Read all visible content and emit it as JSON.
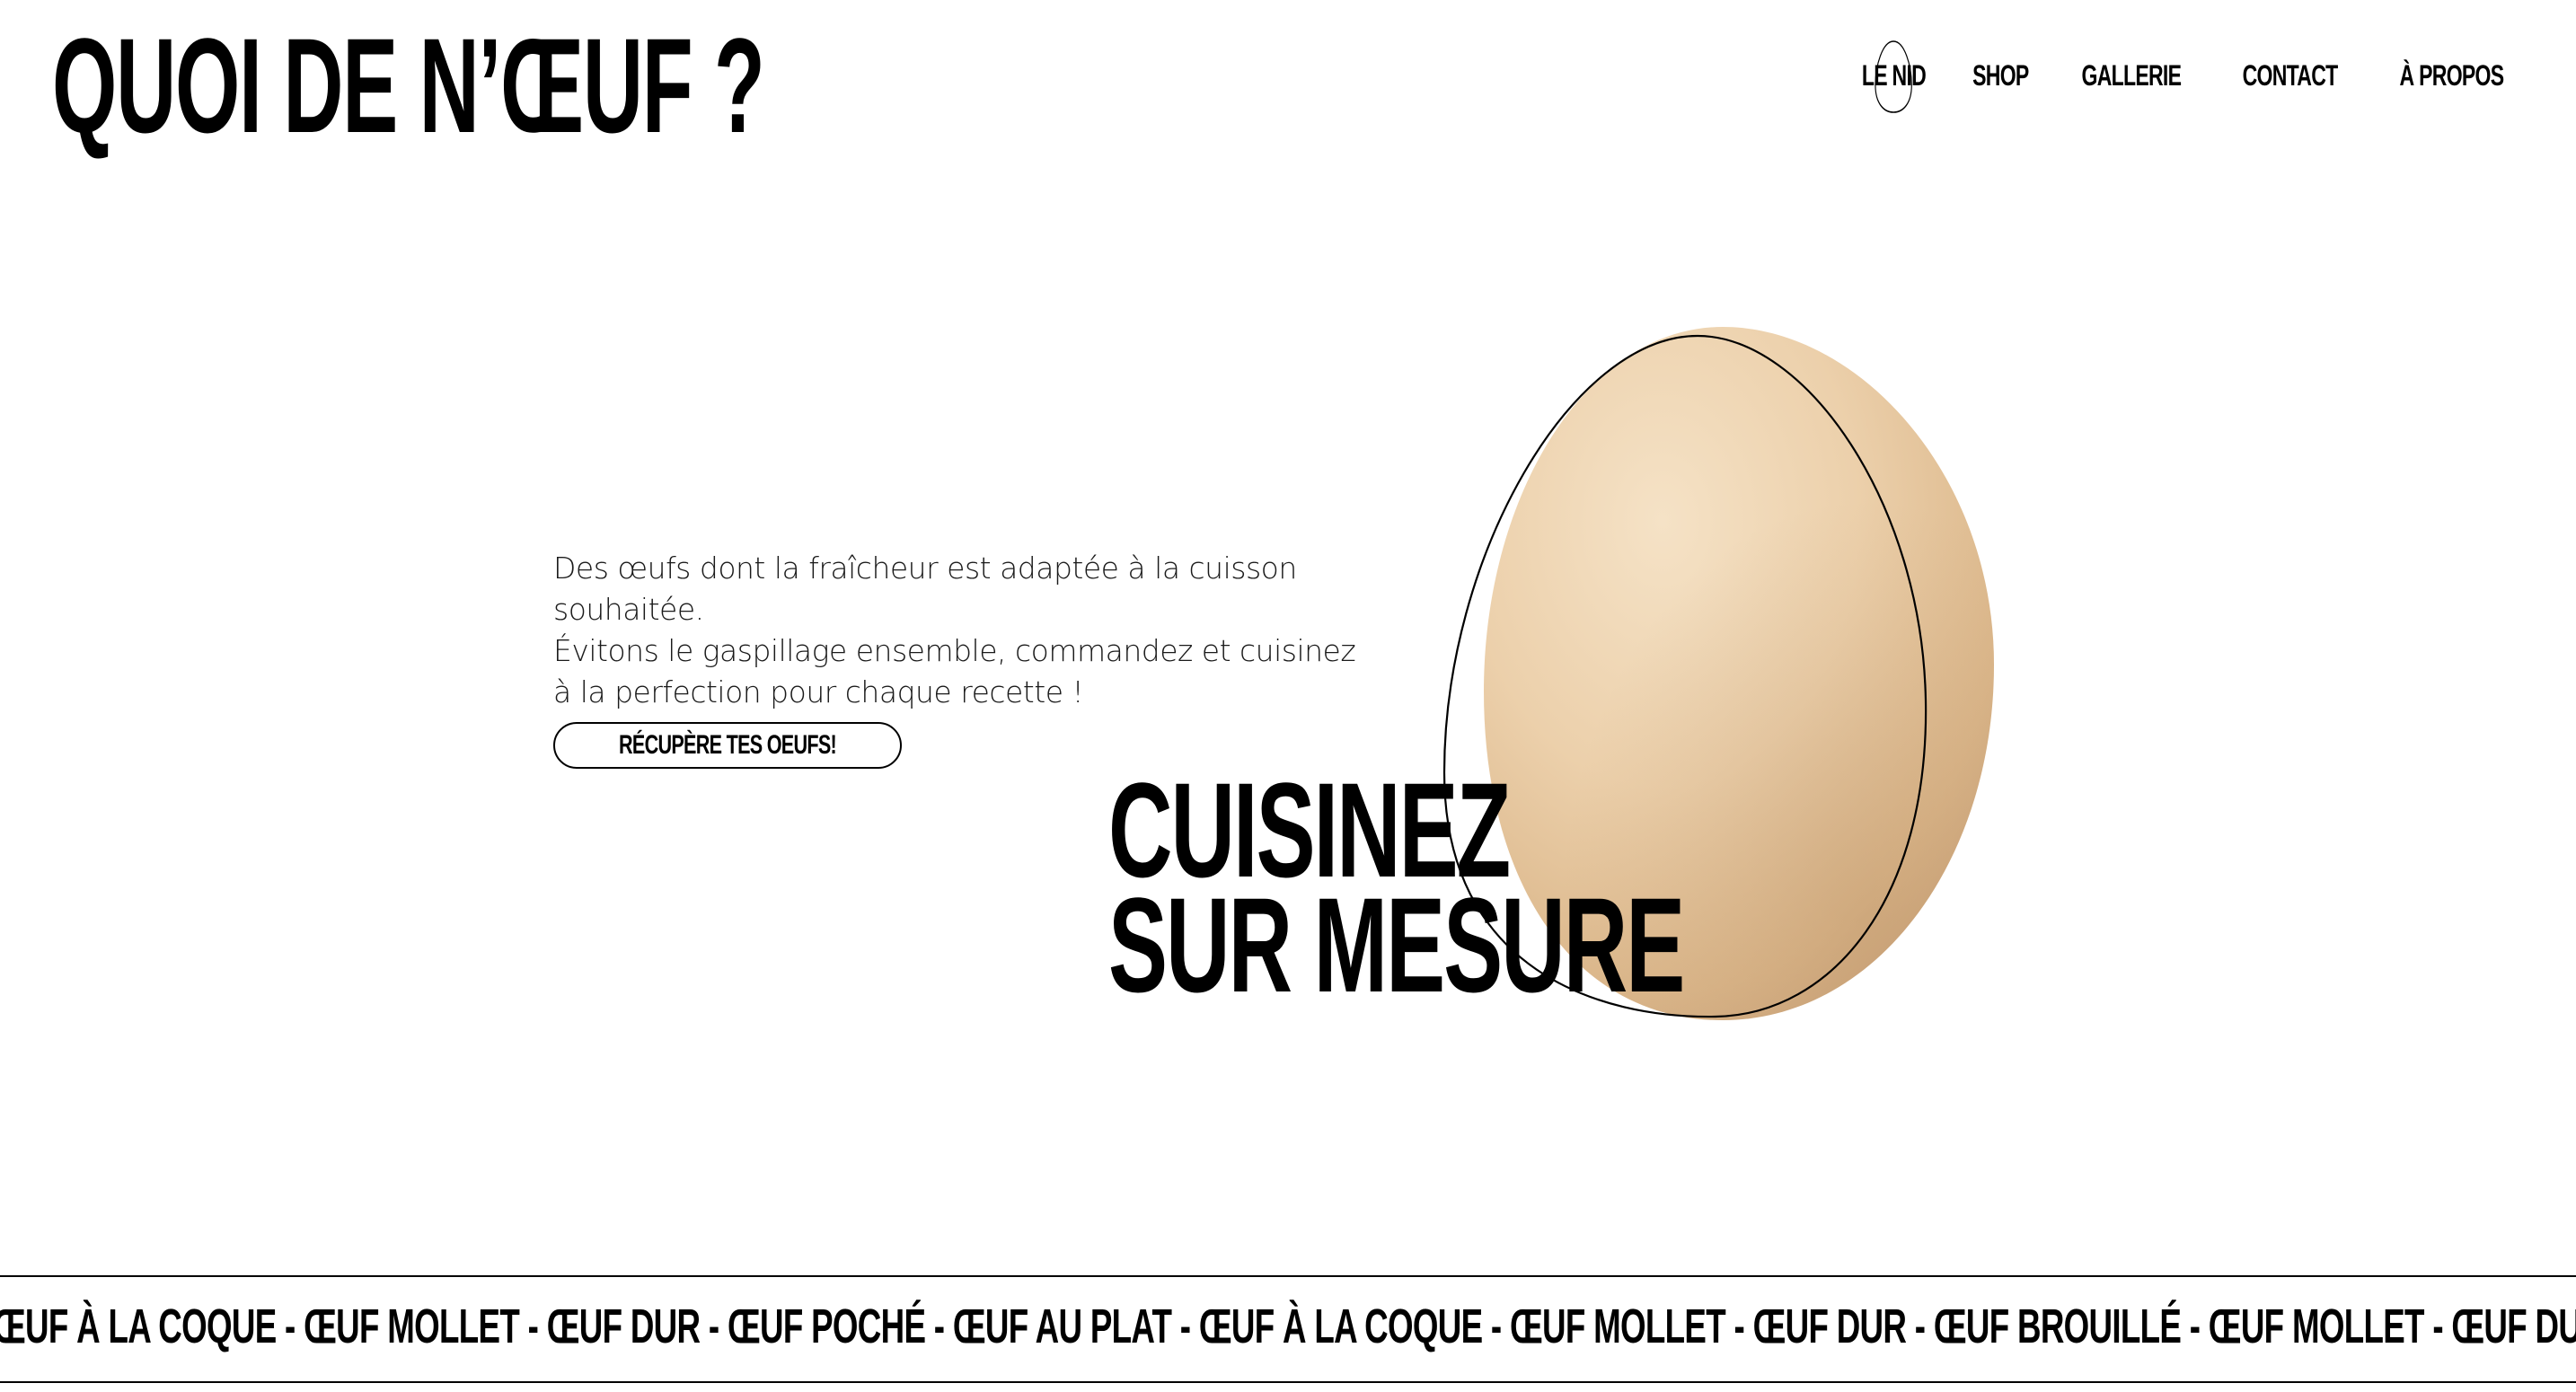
{
  "brand": {
    "logo": "QUOI DE N’ŒUF ?"
  },
  "nav": {
    "items": [
      {
        "label": "LE NID"
      },
      {
        "label": "SHOP"
      },
      {
        "label": "GALLERIE"
      },
      {
        "label": "CONTACT"
      },
      {
        "label": "À PROPOS"
      }
    ]
  },
  "hero": {
    "intro_lines": [
      "Des œufs dont la fraîcheur est adaptée à la cuisson souhaitée.",
      "Évitons le gaspillage ensemble, commandez et cuisinez",
      "à la perfection pour chaque recette !"
    ],
    "cta_label": "RÉCUPÈRE TES OEUFS!",
    "headline_line1": "CUISINEZ",
    "headline_line2": "SUR MESURE"
  },
  "marquee": {
    "text": "ŒUF À LA COQUE - ŒUF MOLLET - ŒUF DUR - ŒUF POCHÉ - ŒUF AU PLAT - ŒUF À LA COQUE - ŒUF MOLLET - ŒUF DUR  - ŒUF BROUILLÉ - ŒUF MOLLET - ŒUF DUR - ŒUF POCHÉ - ŒUF AU PLAT -"
  },
  "colors": {
    "background": "#ffffff",
    "text": "#000000",
    "egg_light": "#f1d9b8",
    "egg_mid": "#e6c49a",
    "egg_dark": "#c9a478"
  }
}
